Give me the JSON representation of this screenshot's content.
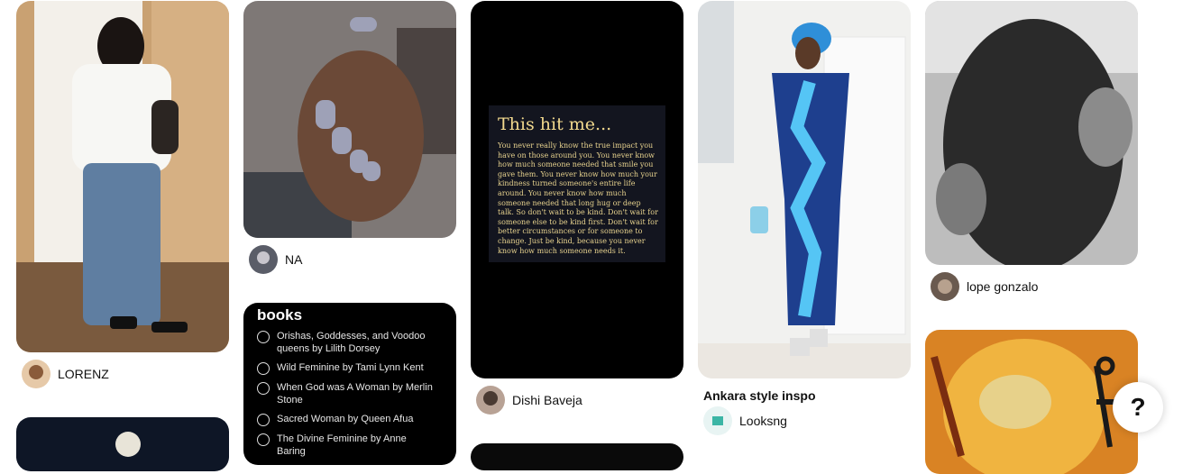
{
  "pins": [
    {
      "author": "LORENZ"
    },
    {
      "author": "NA"
    },
    {
      "books_card": {
        "heading": "books",
        "items": [
          "Orishas, Goddesses, and Voodoo queens by Lilith Dorsey",
          "Wild Feminine by Tami Lynn Kent",
          "When God was A Woman by Merlin Stone",
          "Sacred Woman by Queen Afua",
          "The Divine Feminine by Anne Baring"
        ]
      }
    },
    {
      "author": "Dishi Baveja",
      "quote_card": {
        "heading": "This hit me...",
        "body": "You never really know the true impact you have on those around you. You never know how much someone needed that smile you gave them. You never know how much your kindness turned someone's entire life around. You never know how much someone needed that long hug or deep talk. So don't wait to be kind. Don't wait for someone else to be kind first. Don't wait for better circumstances or for someone to change. Just be kind, because you never know how much someone needs it."
      }
    },
    {
      "title": "Ankara style inspo",
      "author": "Looksng"
    },
    {
      "author": "lope gonzalo"
    }
  ],
  "help_button": {
    "label": "?"
  }
}
